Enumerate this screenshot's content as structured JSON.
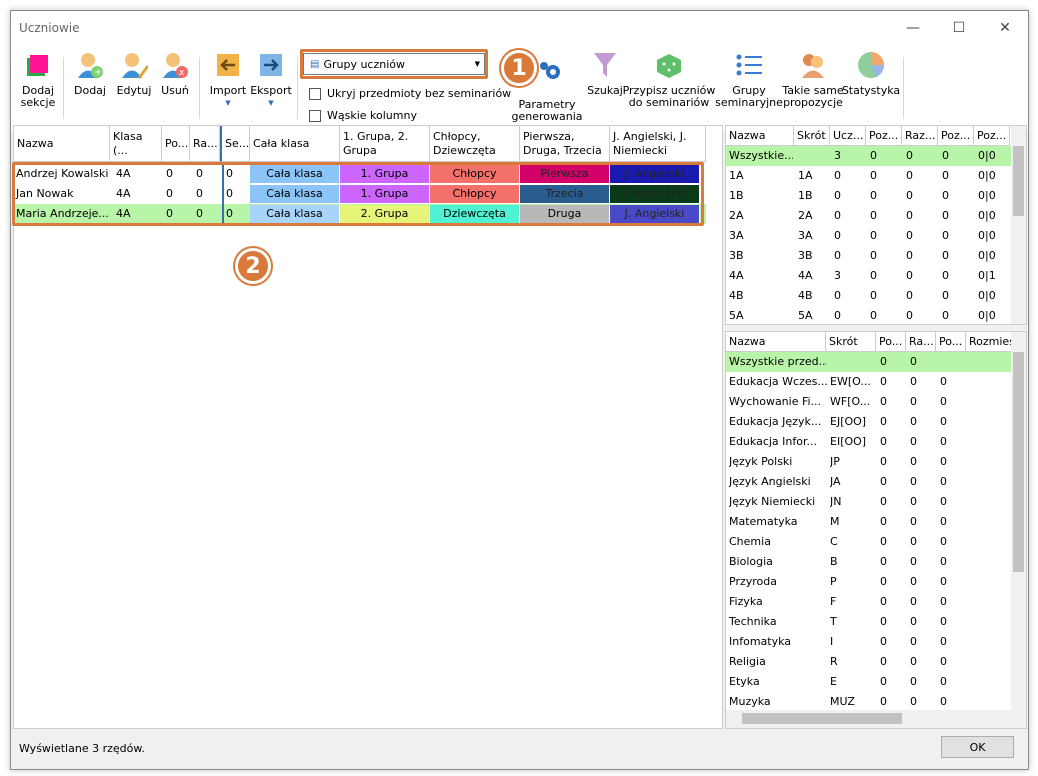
{
  "window": {
    "title": "Uczniowie"
  },
  "toolbar": {
    "add_section": "Dodaj\nsekcje",
    "add": "Dodaj",
    "edit": "Edytuj",
    "delete": "Usuń",
    "import": "Import",
    "export": "Eksport",
    "view_select": "Grupy uczniów",
    "hide_subjects": "Ukryj przedmioty bez seminariów",
    "narrow_columns": "Wąskie kolumny",
    "params": "Parametry\ngenerowania",
    "search": "Szukaj",
    "assign": "Przypisz uczniów\ndo seminariów",
    "groups": "Grupy\nseminaryjne",
    "same": "Takie same\npropozycje",
    "stats": "Statystyka"
  },
  "callouts": {
    "one": "1",
    "two": "2"
  },
  "main_table": {
    "headers": [
      "Nazwa",
      "Klasa (...",
      "Po...",
      "Ra...",
      "Se...",
      "Cała klasa",
      "1. Grupa, 2.\nGrupa",
      "Chłopcy,\nDziewczęta",
      "Pierwsza,\nDruga, Trzecia",
      "J. Angielski, J.\nNiemiecki"
    ],
    "rows": [
      {
        "name": "Andrzej Kowalski",
        "klasa": "4A",
        "po": "0",
        "ra": "0",
        "se": "0",
        "cala": "Cała klasa",
        "grupa": "1. Grupa",
        "plec": "Chłopcy",
        "kolejnosc": "Pierwsza",
        "jezyk": "J. Angielski"
      },
      {
        "name": "Jan Nowak",
        "klasa": "4A",
        "po": "0",
        "ra": "0",
        "se": "0",
        "cala": "Cała klasa",
        "grupa": "1. Grupa",
        "plec": "Chłopcy",
        "kolejnosc": "Trzecia",
        "jezyk": "J. Niemiecki"
      },
      {
        "name": "Maria Andrzeje...",
        "klasa": "4A",
        "po": "0",
        "ra": "0",
        "se": "0",
        "cala": "Cała klasa",
        "grupa": "2. Grupa",
        "plec": "Dziewczęta",
        "kolejnosc": "Druga",
        "jezyk": "J. Angielski"
      }
    ],
    "colors": {
      "cala": "#8cc4f8",
      "grupa1": "#cc66ff",
      "grupa2": "#e6f57a",
      "chlopcy": "#f4716b",
      "dziewczeta": "#4ff2d2",
      "pierwsza": "#d4006a",
      "trzecia": "#2a5d8f",
      "druga": "#b8b8b8",
      "angielski": "#4a4ac8",
      "niemiecki": "#0a3a18"
    }
  },
  "classes_table": {
    "headers": [
      "Nazwa",
      "Skrót",
      "Ucz...",
      "Poz...",
      "Raz...",
      "Poz...",
      "Poz..."
    ],
    "rows": [
      [
        "Wszystkie...",
        "",
        "3",
        "0",
        "0",
        "0",
        "0|0"
      ],
      [
        "1A",
        "1A",
        "0",
        "0",
        "0",
        "0",
        "0|0"
      ],
      [
        "1B",
        "1B",
        "0",
        "0",
        "0",
        "0",
        "0|0"
      ],
      [
        "2A",
        "2A",
        "0",
        "0",
        "0",
        "0",
        "0|0"
      ],
      [
        "3A",
        "3A",
        "0",
        "0",
        "0",
        "0",
        "0|0"
      ],
      [
        "3B",
        "3B",
        "0",
        "0",
        "0",
        "0",
        "0|0"
      ],
      [
        "4A",
        "4A",
        "3",
        "0",
        "0",
        "0",
        "0|1"
      ],
      [
        "4B",
        "4B",
        "0",
        "0",
        "0",
        "0",
        "0|0"
      ],
      [
        "5A",
        "5A",
        "0",
        "0",
        "0",
        "0",
        "0|0"
      ]
    ]
  },
  "subjects_table": {
    "headers": [
      "Nazwa",
      "Skrót",
      "Po...",
      "Ra...",
      "Po...",
      "Rozmies"
    ],
    "rows": [
      [
        "Wszystkie przed...",
        "",
        "0",
        "0",
        "",
        ""
      ],
      [
        "Edukacja Wczes...",
        "EW[O...",
        "0",
        "0",
        "0",
        ""
      ],
      [
        "Wychowanie Fi...",
        "WF[O...",
        "0",
        "0",
        "0",
        ""
      ],
      [
        "Edukacja Język...",
        "EJ[OO]",
        "0",
        "0",
        "0",
        ""
      ],
      [
        "Edukacja Infor...",
        "EI[OO]",
        "0",
        "0",
        "0",
        ""
      ],
      [
        "Język Polski",
        "JP",
        "0",
        "0",
        "0",
        ""
      ],
      [
        "Język Angielski",
        "JA",
        "0",
        "0",
        "0",
        ""
      ],
      [
        "Język Niemiecki",
        "JN",
        "0",
        "0",
        "0",
        ""
      ],
      [
        "Matematyka",
        "M",
        "0",
        "0",
        "0",
        ""
      ],
      [
        "Chemia",
        "C",
        "0",
        "0",
        "0",
        ""
      ],
      [
        "Biologia",
        "B",
        "0",
        "0",
        "0",
        ""
      ],
      [
        "Przyroda",
        "P",
        "0",
        "0",
        "0",
        ""
      ],
      [
        "Fizyka",
        "F",
        "0",
        "0",
        "0",
        ""
      ],
      [
        "Technika",
        "T",
        "0",
        "0",
        "0",
        ""
      ],
      [
        "Infomatyka",
        "I",
        "0",
        "0",
        "0",
        ""
      ],
      [
        "Religia",
        "R",
        "0",
        "0",
        "0",
        ""
      ],
      [
        "Etyka",
        "E",
        "0",
        "0",
        "0",
        ""
      ],
      [
        "Muzyka",
        "MUZ",
        "0",
        "0",
        "0",
        ""
      ]
    ]
  },
  "status": {
    "text": "Wyświetlane 3 rzędów.",
    "ok": "OK"
  },
  "accent": "#d9793a",
  "highlight": "#b9f5a8"
}
